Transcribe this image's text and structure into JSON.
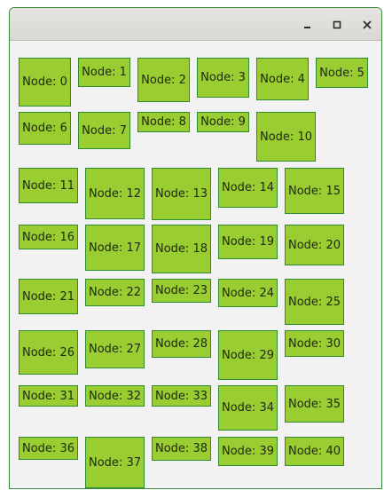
{
  "window": {
    "title": "",
    "controls": [
      "minimize-icon",
      "maximize-icon",
      "close-icon"
    ]
  },
  "colors": {
    "node_fill": "#9acd32",
    "node_border": "#2e8b2e",
    "window_border": "#3c8a3c",
    "background": "#f2f2f2"
  },
  "nodes": [
    "Node: 0",
    "Node: 1",
    "Node: 2",
    "Node: 3",
    "Node: 4",
    "Node: 5",
    "Node: 6",
    "Node: 7",
    "Node: 8",
    "Node: 9",
    "Node: 10",
    "Node: 11",
    "Node: 12",
    "Node: 13",
    "Node: 14",
    "Node: 15",
    "Node: 16",
    "Node: 17",
    "Node: 18",
    "Node: 19",
    "Node: 20",
    "Node: 21",
    "Node: 22",
    "Node: 23",
    "Node: 24",
    "Node: 25",
    "Node: 26",
    "Node: 27",
    "Node: 28",
    "Node: 29",
    "Node: 30",
    "Node: 31",
    "Node: 32",
    "Node: 33",
    "Node: 34",
    "Node: 35",
    "Node: 36",
    "Node: 37",
    "Node: 38",
    "Node: 39",
    "Node: 40"
  ]
}
